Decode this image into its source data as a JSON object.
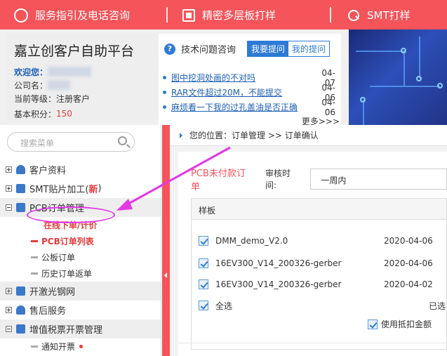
{
  "topbar": {
    "items": [
      {
        "label": "服务指引及电话咨询",
        "icon": "service-icon"
      },
      {
        "label": "精密多层板打样",
        "icon": "chip-icon"
      },
      {
        "label": "SMT打样",
        "icon": "smt-icon"
      }
    ],
    "bg_color": "#f4545a"
  },
  "profile": {
    "title": "嘉立创客户自助平台",
    "welcome_label": "欢迎您：",
    "company_label": "公司名：",
    "level_label": "当前等级：",
    "level_value": "注册客户",
    "score_label": "基本积分：",
    "score_value": "150"
  },
  "qa": {
    "title": "技术问题咨询",
    "tab_ask": "我要提问",
    "tab_mine": "我的提问",
    "items": [
      {
        "title": "图中挖洞处画的不对吗",
        "date": "04-07"
      },
      {
        "title": "RAR文件超过20M，不能提交",
        "date": "04-06"
      },
      {
        "title": "麻烦看一下我的过孔盖油是否正确",
        "date": "04-06"
      }
    ],
    "more": "更多>>>"
  },
  "sidebar": {
    "search_placeholder": "搜索菜单",
    "items": [
      {
        "label": "客户资料"
      },
      {
        "label": "SMT贴片加工(",
        "badge": "新",
        "suffix": ")"
      },
      {
        "label": "PCB订单管理"
      },
      {
        "label": "开激光钢网"
      },
      {
        "label": "售后服务"
      },
      {
        "label": "增值税票开票管理"
      }
    ],
    "pcb_sub": [
      "在线下单/计价",
      "PCB订单列表",
      "公板订单",
      "历史订单返单"
    ],
    "tax_sub": [
      "通知开票"
    ]
  },
  "main": {
    "breadcrumb": "您的位置：订单管理 >> 订单确认",
    "unpaid_tab": "PCB未付款订单",
    "audit_label": "审核时间:",
    "audit_value": "一周内",
    "section_title": "样板",
    "rows": [
      {
        "name": "DMM_demo_V2.0",
        "date": "2020-04-06"
      },
      {
        "name": "16EV300_V14_200326-gerber",
        "date": "2020-04-06"
      },
      {
        "name": "16EV300_V14_200326-gerber",
        "date": "2020-04-02"
      }
    ],
    "select_all": "全选",
    "partial_right": "已选",
    "deduct_label": "使用抵扣金额"
  }
}
